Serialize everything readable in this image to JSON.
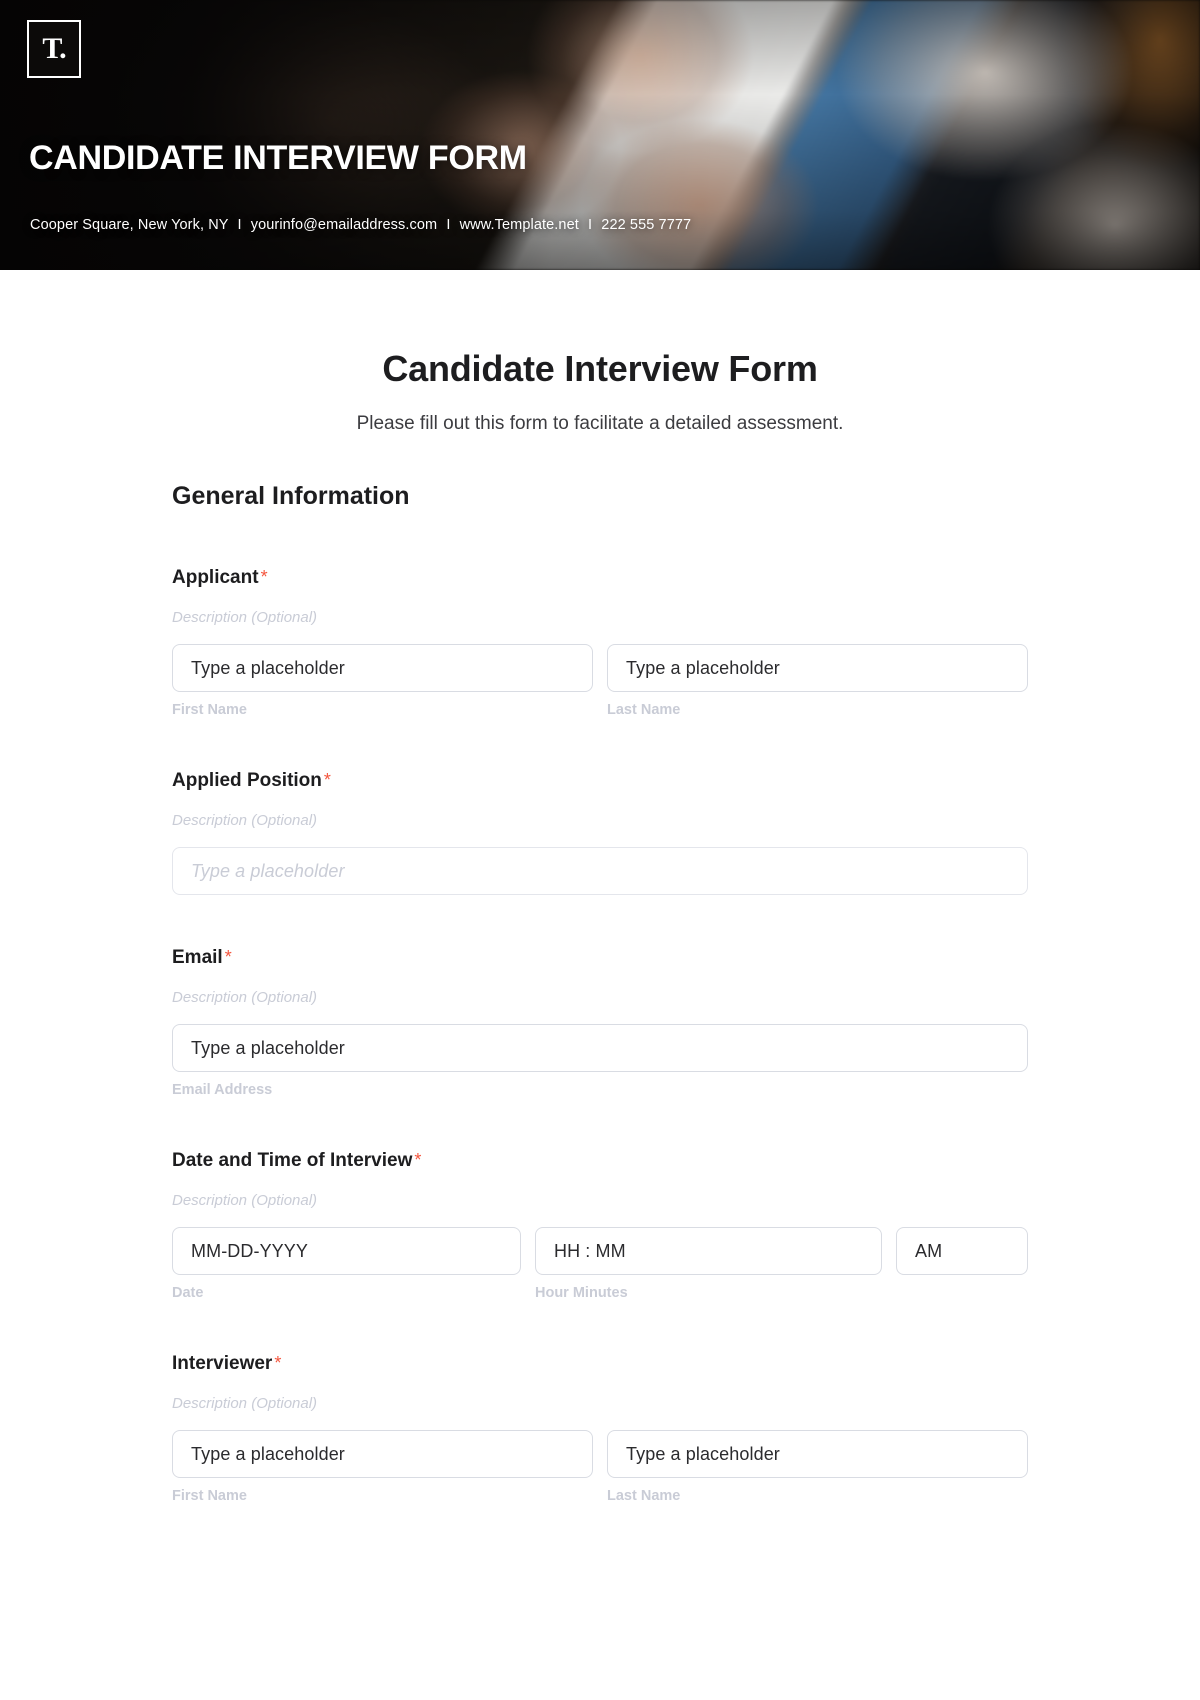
{
  "banner": {
    "logo_glyph": "T.",
    "title": "CANDIDATE INTERVIEW FORM",
    "contact": {
      "address": "Cooper Square, New York, NY",
      "email": "yourinfo@emailaddress.com",
      "website": "www.Template.net",
      "phone": "222 555 7777",
      "separator": "I"
    }
  },
  "form": {
    "title": "Candidate Interview Form",
    "subtitle": "Please fill out this form to facilitate a detailed assessment.",
    "section_heading": "General Information",
    "required_marker": "*",
    "description_placeholder": "Description (Optional)",
    "fields": [
      {
        "label": "Applicant",
        "description": "Description (Optional)",
        "inputs": [
          {
            "placeholder": "Type a placeholder",
            "sub_label": "First Name",
            "style": "normal"
          },
          {
            "placeholder": "Type a placeholder",
            "sub_label": "Last Name",
            "style": "normal"
          }
        ]
      },
      {
        "label": "Applied Position",
        "description": "Description (Optional)",
        "inputs": [
          {
            "placeholder": "Type a placeholder",
            "sub_label": "",
            "style": "muted"
          }
        ]
      },
      {
        "label": "Email",
        "description": "Description (Optional)",
        "inputs": [
          {
            "placeholder": "Type a placeholder",
            "sub_label": "Email Address",
            "style": "normal"
          }
        ]
      },
      {
        "label": "Date and Time of Interview",
        "description": "Description (Optional)",
        "inputs": [
          {
            "placeholder": "MM-DD-YYYY",
            "sub_label": "Date",
            "style": "normal"
          },
          {
            "placeholder": "HH : MM",
            "sub_label": "Hour Minutes",
            "style": "normal"
          },
          {
            "placeholder": "AM",
            "sub_label": "",
            "style": "normal"
          }
        ]
      },
      {
        "label": "Interviewer",
        "description": "Description (Optional)",
        "inputs": [
          {
            "placeholder": "Type a placeholder",
            "sub_label": "First Name",
            "style": "normal"
          },
          {
            "placeholder": "Type a placeholder",
            "sub_label": "Last Name",
            "style": "normal"
          }
        ]
      }
    ]
  },
  "colors": {
    "required_star": "#f4553d",
    "banner_background": "#0b0908",
    "text_primary": "#1d1d1f",
    "muted": "#c9ccd6",
    "border": "#d9dce3"
  }
}
